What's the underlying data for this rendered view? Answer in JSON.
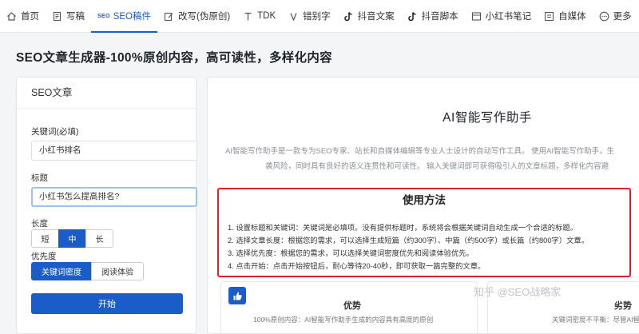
{
  "nav": {
    "items": [
      {
        "label": "首页",
        "icon": "home-icon"
      },
      {
        "label": "写稿",
        "icon": "document-icon"
      },
      {
        "label": "SEO稿件",
        "icon": "seo-icon",
        "badge": "SEO"
      },
      {
        "label": "改写(伪原创)",
        "icon": "edit-icon"
      },
      {
        "label": "TDK",
        "icon": "text-t-icon"
      },
      {
        "label": "错别字",
        "icon": "typo-icon"
      },
      {
        "label": "抖音文案",
        "icon": "tiktok-icon"
      },
      {
        "label": "抖音脚本",
        "icon": "tiktok-icon"
      },
      {
        "label": "小红书笔记",
        "icon": "notebook-icon"
      },
      {
        "label": "自媒体",
        "icon": "media-icon"
      },
      {
        "label": "更多",
        "icon": "more-icon"
      }
    ],
    "active_index": 2
  },
  "page": {
    "title": "SEO文章生成器-100%原创内容，高可读性，多样化内容"
  },
  "form": {
    "panel_title": "SEO文章",
    "keyword_label": "关键词(必填)",
    "keyword_value": "小红书排名",
    "title_label": "标题",
    "title_value": "小红书怎么提高排名?",
    "length_label": "长度",
    "length_options": [
      "短",
      "中",
      "长"
    ],
    "length_selected": "中",
    "priority_label": "优先度",
    "priority_options": [
      "关键词密度",
      "阅读体验"
    ],
    "priority_selected": "关键词密度",
    "start_label": "开始"
  },
  "assistant": {
    "title": "AI智能写作助手",
    "desc_line1": "AI智能写作助手是一款专为SEO专家、站长和自媒体编辑等专业人士设计的自动写作工具。 使用AI智能写作助手，生",
    "desc_line2": "袭风险，同时具有良好的语义连贯性和可读性。 输入关键词即可获得吸引人的文章标题，多样化内容避",
    "usage_title": "使用方法",
    "steps": [
      "1. 设置标题和关键词：关键词是必填项。没有提供标题时，系统将会根据关键词自动生成一个合适的标题。",
      "2. 选择文章长度：根据您的需求，可以选择生成短篇（约300字）、中篇（约500字）或长篇（约800字）文章。",
      "3. 选择优先度：根据您的需求，可以选择关键词密度优先和阅读体验优先。",
      "4. 点击开始：点击开始按钮后，耐心等待20-40秒，即可获取一篇完整的文章。"
    ],
    "card_left_title": "优势",
    "card_left_text": "100%原创内容：AI智能写作助手生成的内容具有高度的原创",
    "card_right_title": "劣势",
    "card_right_text": "关键词密度不平衡：尽管AI智能写作"
  },
  "watermark": "知乎 @SEO战略家",
  "colors": {
    "accent": "#1a5cc8",
    "highlight_border": "#d8232a"
  }
}
